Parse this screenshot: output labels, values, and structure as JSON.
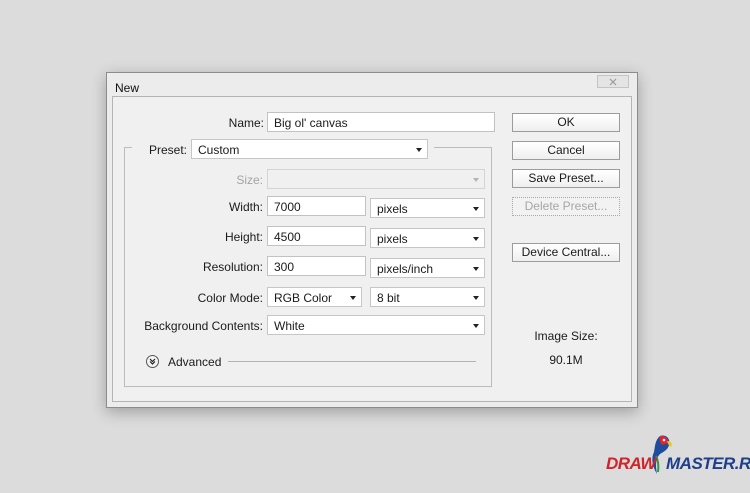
{
  "dialog": {
    "title": "New",
    "name_label": "Name:",
    "name_value": "Big ol' canvas",
    "preset_label": "Preset:",
    "preset_value": "Custom",
    "size_label": "Size:",
    "size_value": "",
    "width_label": "Width:",
    "width_value": "7000",
    "width_unit": "pixels",
    "height_label": "Height:",
    "height_value": "4500",
    "height_unit": "pixels",
    "resolution_label": "Resolution:",
    "resolution_value": "300",
    "resolution_unit": "pixels/inch",
    "color_mode_label": "Color Mode:",
    "color_mode_value": "RGB Color",
    "bit_depth_value": "8 bit",
    "background_label": "Background Contents:",
    "background_value": "White",
    "advanced_label": "Advanced"
  },
  "buttons": {
    "ok": "OK",
    "cancel": "Cancel",
    "save_preset": "Save Preset...",
    "delete_preset": "Delete Preset...",
    "device_central": "Device Central..."
  },
  "image_size": {
    "label": "Image Size:",
    "value": "90.1M"
  },
  "watermark": {
    "text_left": "DRAW",
    "text_right": "MASTER.RU",
    "color_left": "#d1232a",
    "color_right": "#1e3f8c"
  }
}
